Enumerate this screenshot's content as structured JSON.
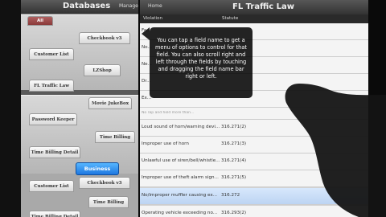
{
  "left_panel": {
    "title": "Databases",
    "manage_label": "Manage",
    "all_tab": "All",
    "tabs_row1": [
      "Checkbook v3",
      "Customer List",
      "LZShop",
      "FL Traffic Law",
      "Movie JukeBox",
      "Password Keeper",
      "Time Billing",
      "Time Billing Detail"
    ],
    "business_button": "Business",
    "tabs_row2": [
      "Checkbook v3",
      "Customer List",
      "Time Billing",
      "Time Billing Detail"
    ]
  },
  "right_panel": {
    "home_label": "Home",
    "title": "FL Traffic Law",
    "columns": [
      "Violation",
      "Statute"
    ],
    "rows": [
      {
        "violation": "Fa...",
        "statute": ""
      },
      {
        "violation": "No...",
        "statute": ""
      },
      {
        "violation": "Ne...",
        "statute": ""
      },
      {
        "violation": "Dr...",
        "statute": ""
      },
      {
        "violation": "Ex...",
        "statute": ""
      },
      {
        "violation": "No Tap and hold more than...",
        "statute": ""
      },
      {
        "violation": "Loud sound of horn/warning devi...",
        "statute": "316.271(2)"
      },
      {
        "violation": "Improper use of horn",
        "statute": "316.271(3)"
      },
      {
        "violation": "Unlawful use of siren/bell/whistle...",
        "statute": "316.271(4)"
      },
      {
        "violation": "Improper use of theft alarm sign...",
        "statute": "316.271(5)"
      },
      {
        "violation": "No/improper muffler causing ex...",
        "statute": "316.272"
      },
      {
        "violation": "Operating vehicle exceeding no...",
        "statute": "316.293(2)"
      }
    ],
    "selected_row_index": 10
  },
  "tooltip": {
    "text": "You can tap a field name to get a menu of options to control for that field.  You can also scroll right and left through the fields by touching and dragging the field name bar right or left."
  }
}
